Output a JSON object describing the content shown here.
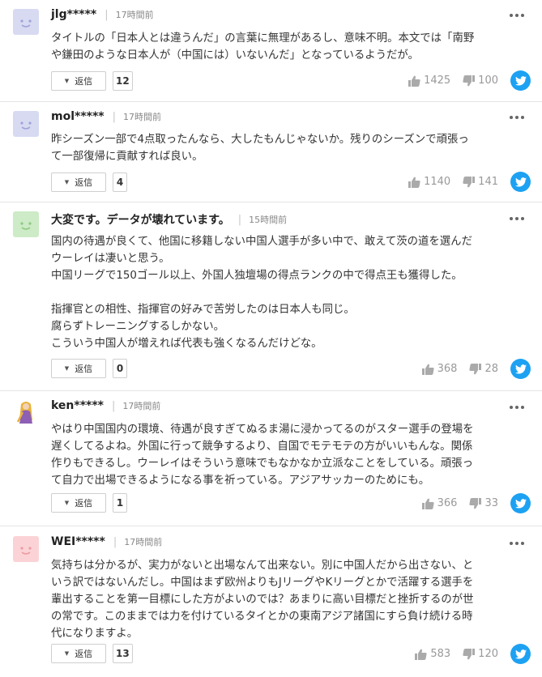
{
  "ui": {
    "reply_label": "返信",
    "accent": "#1da1f2"
  },
  "comments": [
    {
      "user": "jlg*****",
      "time": "17時間前",
      "text": "タイトルの「日本人とは違うんだ」の言葉に無理があるし、意味不明。本文では「南野\nや鎌田のような日本人が（中国には）いないんだ」となっているようだが。",
      "replies": "12",
      "likes": "1425",
      "dislikes": "100"
    },
    {
      "user": "mol*****",
      "time": "17時間前",
      "text": "昨シーズン一部で4点取ったんなら、大したもんじゃないか。残りのシーズンで頑張っ\nて一部復帰に貢献すれば良い。",
      "replies": "4",
      "likes": "1140",
      "dislikes": "141"
    },
    {
      "user": "大変です。データが壊れています。",
      "time": "15時間前",
      "text": "国内の待遇が良くて、他国に移籍しない中国人選手が多い中で、敢えて茨の道を選んだ\nウーレイは凄いと思う。\n中国リーグで150ゴール以上、外国人独壇場の得点ランクの中で得点王も獲得した。\n\n指揮官との相性、指揮官の好みで苦労したのは日本人も同じ。\n腐らずトレーニングするしかない。\nこういう中国人が増えれば代表も強くなるんだけどな。",
      "replies": "0",
      "likes": "368",
      "dislikes": "28"
    },
    {
      "user": "ken*****",
      "time": "17時間前",
      "text": "やはり中国国内の環境、待遇が良すぎてぬるま湯に浸かってるのがスター選手の登場を\n遅くしてるよね。外国に行って競争するより、自国でモテモテの方がいいもんな。関係\n作りもできるし。ウーレイはそういう意味でもなかなか立派なことをしている。頑張っ\nて自力で出場できるようになる事を祈っている。アジアサッカーのためにも。",
      "replies": "1",
      "likes": "366",
      "dislikes": "33"
    },
    {
      "user": "WEI*****",
      "time": "17時間前",
      "text": "気持ちは分かるが、実力がないと出場なんて出来ない。別に中国人だから出さない、と\nいう訳ではないんだし。中国はまず欧州よりもJリーグやKリーグとかで活躍する選手を\n輩出することを第一目標にした方がよいのでは？あまりに高い目標だと挫折するのが世\nの常です。このままでは力を付けているタイとかの東南アジア諸国にすら負け続ける時\n代になりますよ。",
      "replies": "13",
      "likes": "583",
      "dislikes": "120"
    }
  ]
}
